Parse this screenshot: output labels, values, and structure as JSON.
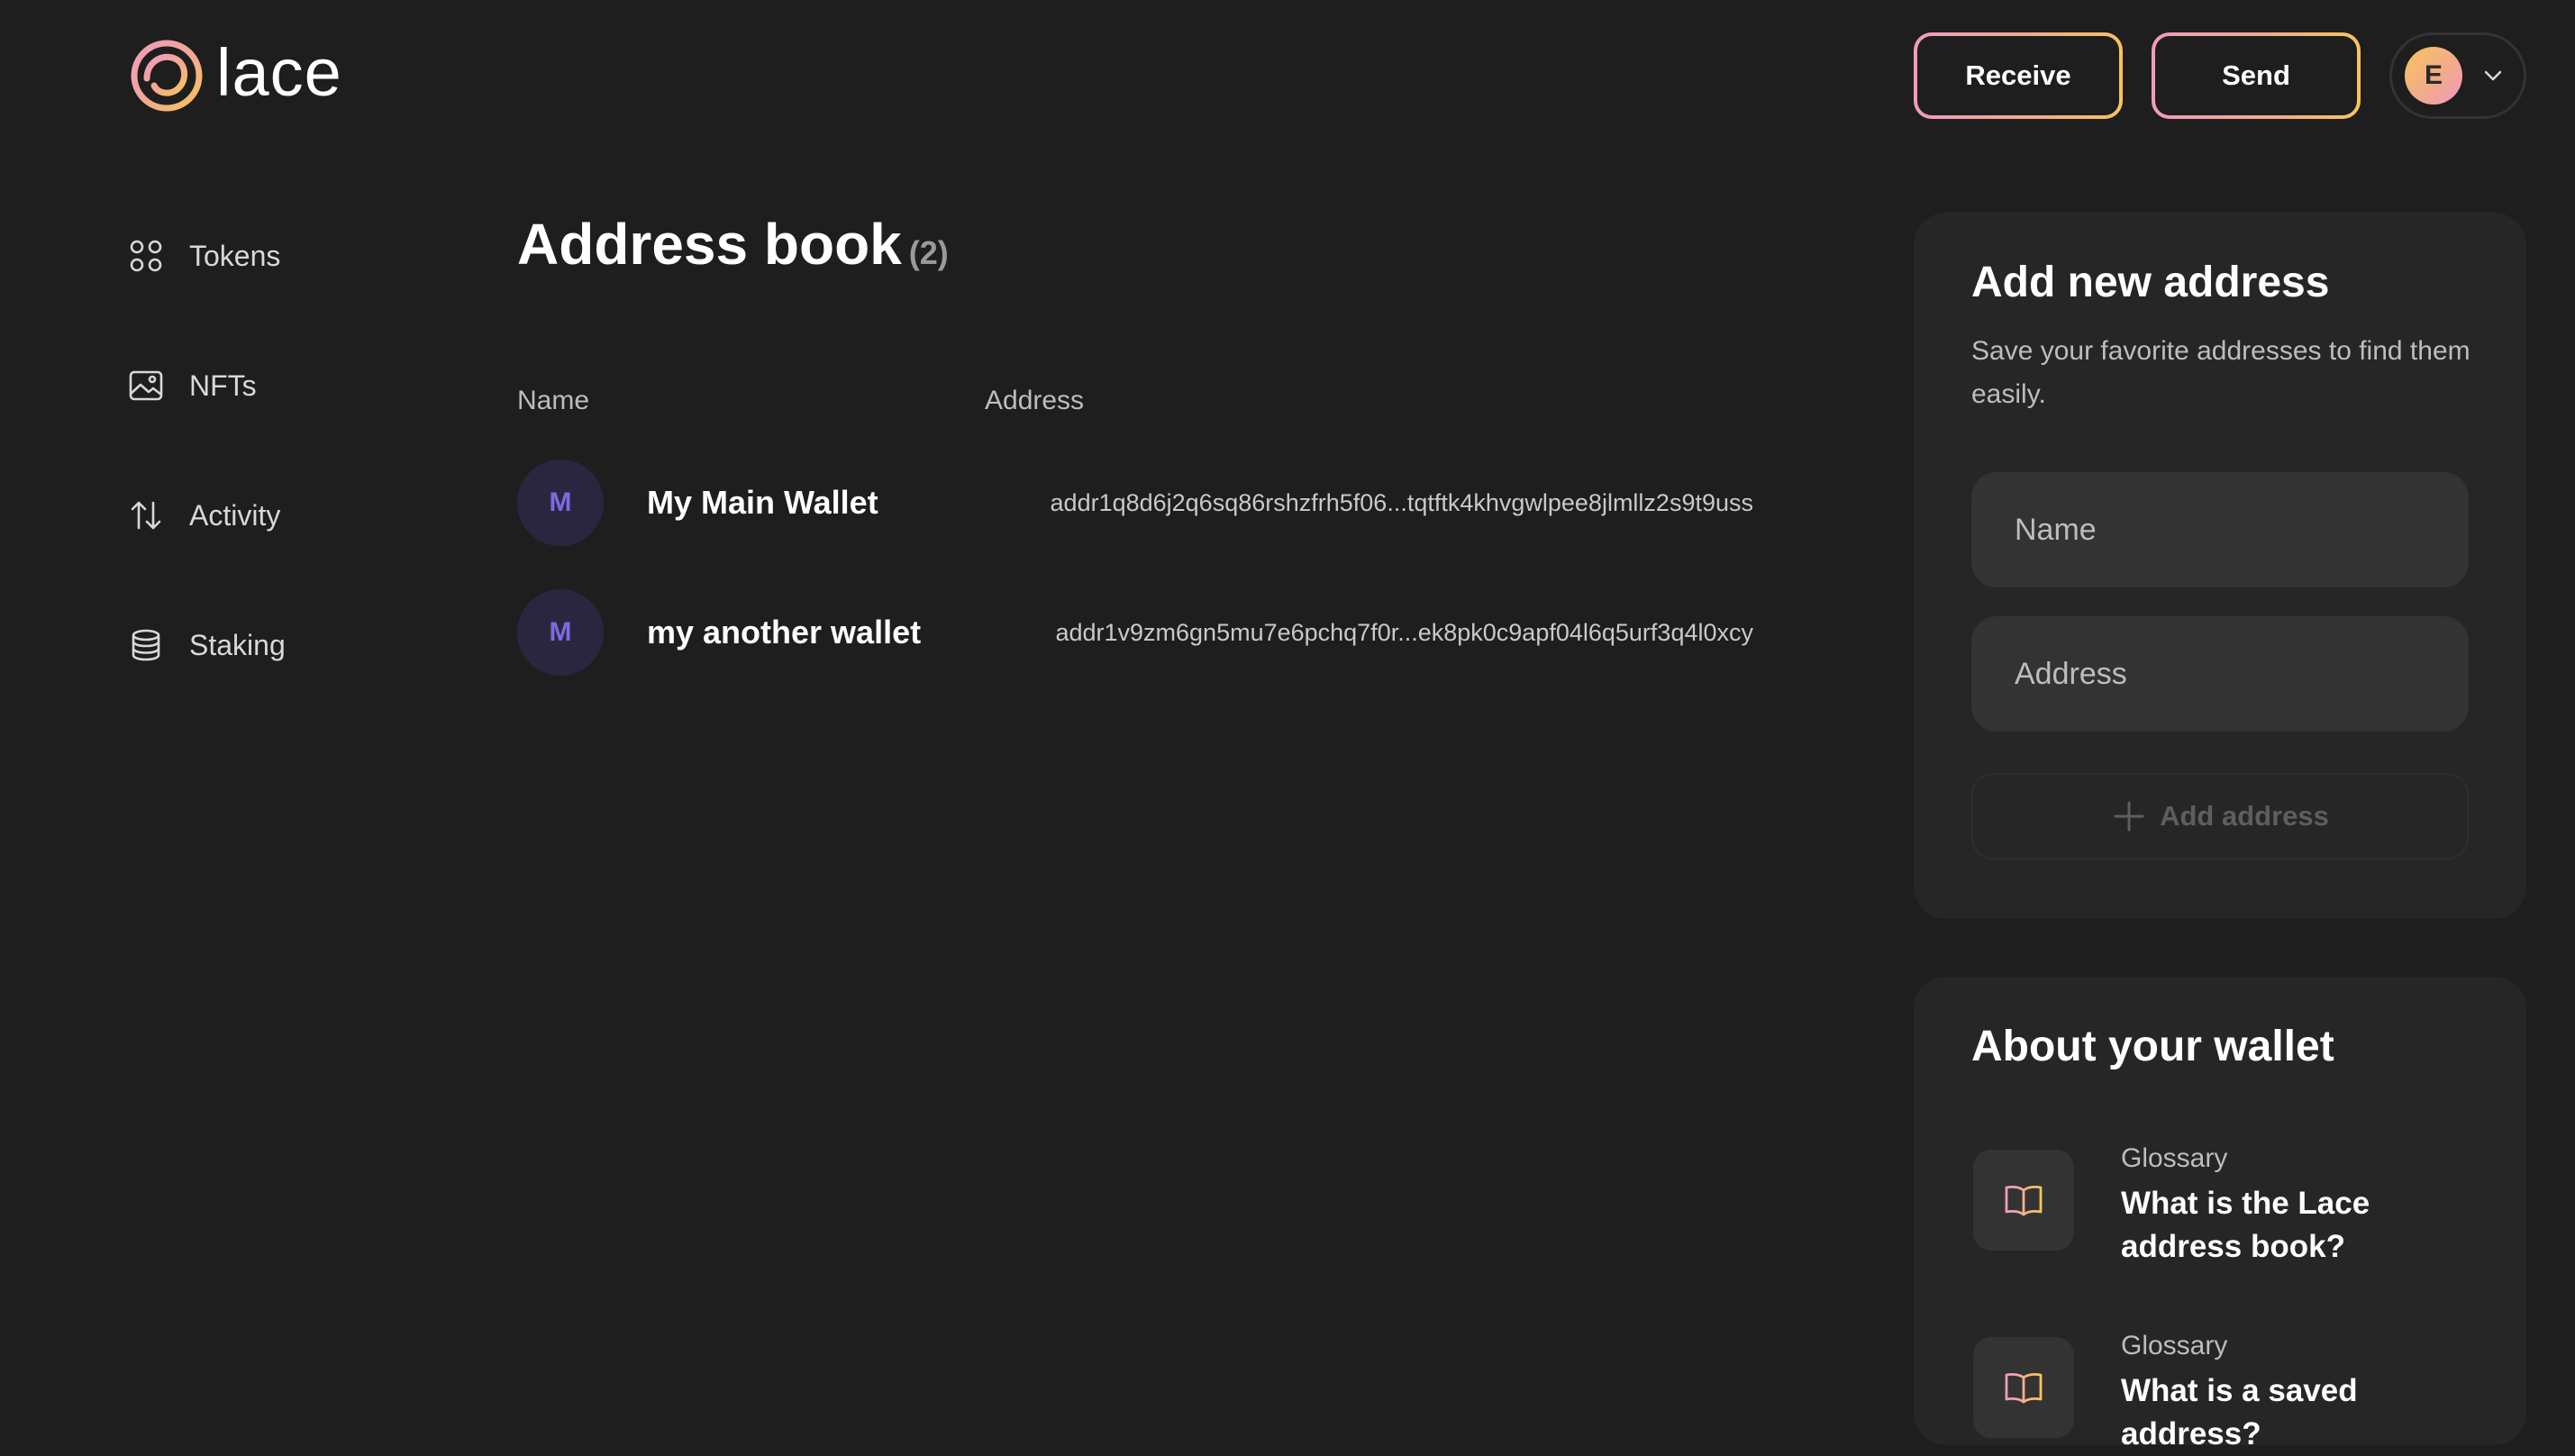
{
  "app": {
    "logo_text": "lace",
    "brand_gradient": [
      "#f09bbf",
      "#f2a98f",
      "#f7c45b"
    ]
  },
  "header": {
    "receive_label": "Receive",
    "send_label": "Send",
    "profile_initial": "E"
  },
  "sidebar": {
    "items": [
      {
        "label": "Tokens",
        "icon": "grid-icon"
      },
      {
        "label": "NFTs",
        "icon": "image-icon"
      },
      {
        "label": "Activity",
        "icon": "arrows-up-down-icon"
      },
      {
        "label": "Staking",
        "icon": "database-icon"
      }
    ]
  },
  "main": {
    "title": "Address book",
    "count": "(2)",
    "columns": {
      "name": "Name",
      "address": "Address"
    },
    "rows": [
      {
        "initial": "M",
        "name": "My Main Wallet",
        "address": "addr1q8d6j2q6sq86rshzfrh5f06...tqtftk4khvgwlpee8jlmllz2s9t9uss"
      },
      {
        "initial": "M",
        "name": "my another wallet",
        "address": "addr1v9zm6gn5mu7e6pchq7f0r...ek8pk0c9apf04l6q5urf3q4l0xcy"
      }
    ]
  },
  "add_card": {
    "title": "Add new address",
    "subtitle": "Save your favorite addresses to find them easily.",
    "name_placeholder": "Name",
    "address_placeholder": "Address",
    "add_label": "Add address"
  },
  "about_card": {
    "title": "About your wallet",
    "items": [
      {
        "category": "Glossary",
        "question": "What is the Lace address book?"
      },
      {
        "category": "Glossary",
        "question": "What is a saved address?"
      }
    ]
  }
}
